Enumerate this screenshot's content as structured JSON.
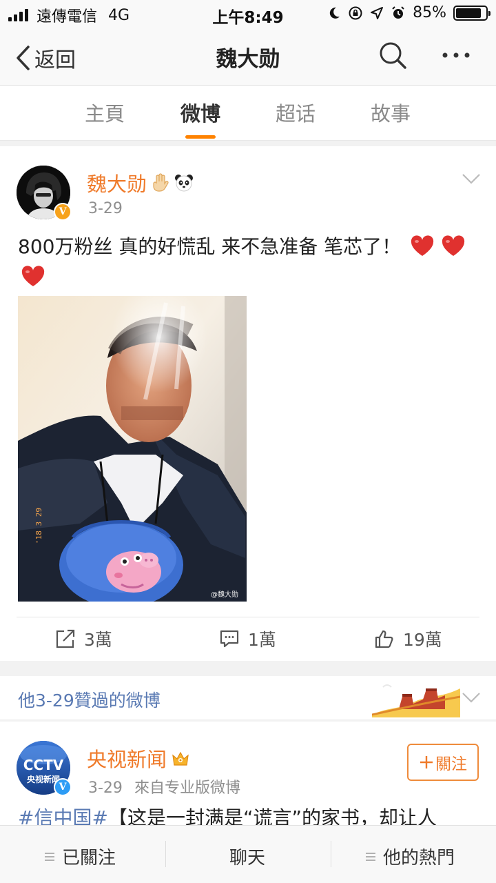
{
  "status": {
    "carrier": "遠傳電信",
    "network": "4G",
    "time": "上午8:49",
    "battery": "85%",
    "battery_level": 0.85
  },
  "nav": {
    "back_label": "返回",
    "title": "魏大勋"
  },
  "tabs": [
    {
      "label": "主頁"
    },
    {
      "label": "微博"
    },
    {
      "label": "超话"
    },
    {
      "label": "故事"
    }
  ],
  "post": {
    "author": "魏大勋",
    "date": "3-29",
    "text": "800万粉丝 真的好慌乱 来不急准备 笔芯了！",
    "photo_watermark": "@魏大勋",
    "photo_stamp": "'18 3 29",
    "actions": {
      "repost": "3萬",
      "comment": "1萬",
      "like": "19萬"
    }
  },
  "liked_section": {
    "label": "他3-29贊過的微博"
  },
  "post2": {
    "author": "央视新闻",
    "date": "3-29",
    "source": "來自专业版微博",
    "follow_label": "關注",
    "avatar_text": "央视新闻",
    "avatar_logo": "CCTV",
    "hashtag": "#信中国#",
    "text": "【这是一封满是“谎言”的家书，却让人"
  },
  "bottom": {
    "following": "已關注",
    "chat": "聊天",
    "hot": "他的熱門"
  },
  "colors": {
    "accent": "#ff8200",
    "author_name": "#ef7a2a",
    "link": "#5a7ab3",
    "heart": "#e0312f"
  }
}
